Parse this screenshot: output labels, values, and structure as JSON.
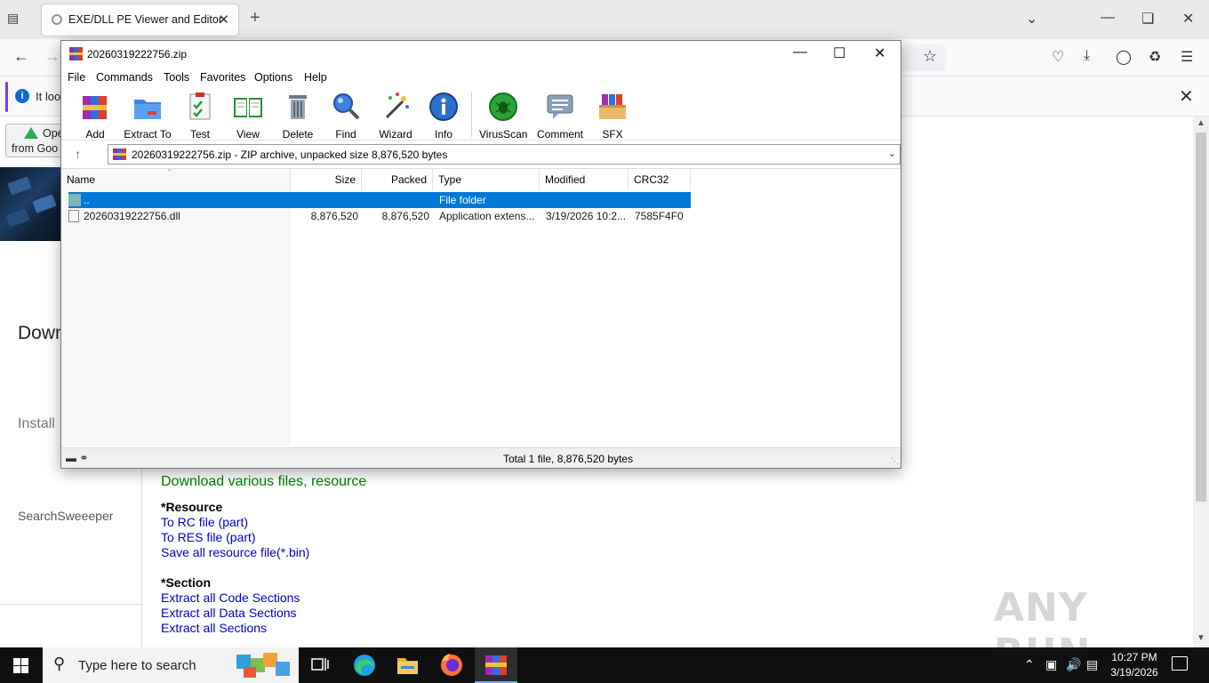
{
  "browser": {
    "tab_title": "EXE/DLL PE Viewer and Editor",
    "notice_text": "It loo"
  },
  "page": {
    "drive_button_line1": "Ope",
    "drive_button_line2": "from Goo",
    "left_heading": "Down",
    "left_install": "Install",
    "left_search": "SearchSweeeper",
    "green_heading": "Download various files, resource",
    "resource_heading": "*Resource",
    "resource_links": [
      "To RC file (part)",
      "To RES file (part)",
      "Save all resource file(*.bin)"
    ],
    "section_heading": "*Section",
    "section_links": [
      "Extract all Code Sections",
      "Extract all Data Sections",
      "Extract all Sections"
    ],
    "watermark": "ANY RUN"
  },
  "winrar": {
    "title": "20260319222756.zip",
    "menu": [
      "File",
      "Commands",
      "Tools",
      "Favorites",
      "Options",
      "Help"
    ],
    "toolbar": [
      "Add",
      "Extract To",
      "Test",
      "View",
      "Delete",
      "Find",
      "Wizard",
      "Info",
      "VirusScan",
      "Comment",
      "SFX"
    ],
    "path": "20260319222756.zip - ZIP archive, unpacked size 8,876,520 bytes",
    "columns": [
      "Name",
      "Size",
      "Packed",
      "Type",
      "Modified",
      "CRC32"
    ],
    "rows": [
      {
        "name": "..",
        "size": "",
        "packed": "",
        "type": "File folder",
        "modified": "",
        "crc": ""
      },
      {
        "name": "20260319222756.dll",
        "size": "8,876,520",
        "packed": "8,876,520",
        "type": "Application extens...",
        "modified": "3/19/2026 10:2...",
        "crc": "7585F4F0"
      }
    ],
    "status": "Total 1 file, 8,876,520 bytes"
  },
  "taskbar": {
    "search_placeholder": "Type here to search",
    "time": "10:27 PM",
    "date": "3/19/2026"
  }
}
